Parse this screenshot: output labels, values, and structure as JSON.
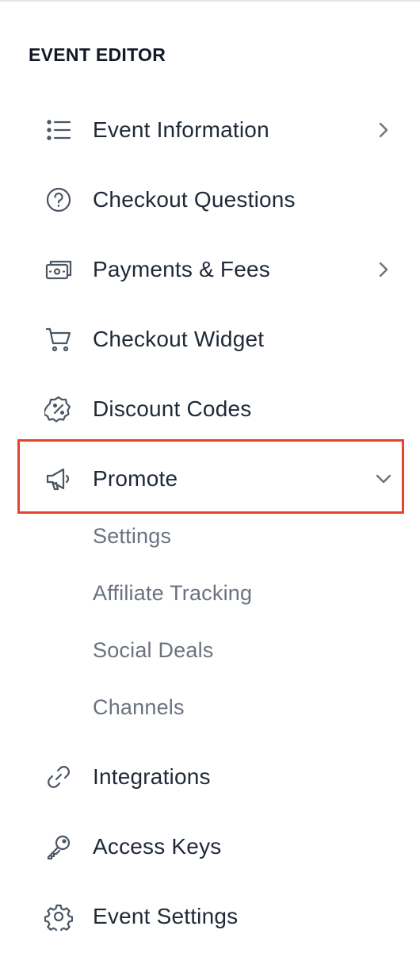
{
  "sidebar": {
    "title": "EVENT EDITOR",
    "items": [
      {
        "label": "Event Information",
        "icon": "list-icon",
        "chevron": "right"
      },
      {
        "label": "Checkout Questions",
        "icon": "question-circle-icon",
        "chevron": ""
      },
      {
        "label": "Payments & Fees",
        "icon": "money-icon",
        "chevron": "right"
      },
      {
        "label": "Checkout Widget",
        "icon": "cart-icon",
        "chevron": ""
      },
      {
        "label": "Discount Codes",
        "icon": "discount-badge-icon",
        "chevron": ""
      },
      {
        "label": "Promote",
        "icon": "megaphone-icon",
        "chevron": "down"
      },
      {
        "label": "Integrations",
        "icon": "link-icon",
        "chevron": ""
      },
      {
        "label": "Access Keys",
        "icon": "key-icon",
        "chevron": ""
      },
      {
        "label": "Event Settings",
        "icon": "gear-icon",
        "chevron": ""
      }
    ],
    "promote_subitems": [
      {
        "label": "Settings"
      },
      {
        "label": "Affiliate Tracking"
      },
      {
        "label": "Social Deals"
      },
      {
        "label": "Channels"
      }
    ]
  },
  "colors": {
    "highlight_border": "#e5432d",
    "text_primary": "#1f2937",
    "text_secondary": "#6b7280",
    "icon": "#4b5563"
  }
}
